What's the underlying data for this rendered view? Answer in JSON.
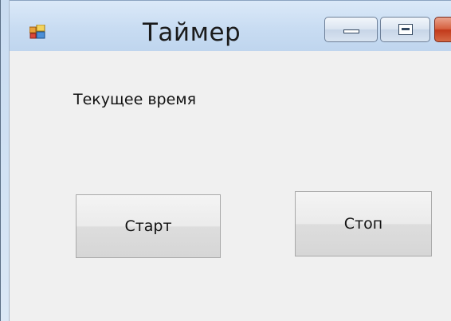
{
  "window": {
    "title": "Таймер",
    "app_icon": "windows-form-icon",
    "controls": {
      "minimize_icon": "minimize-icon",
      "maximize_icon": "maximize-icon",
      "close_icon": "close-icon"
    }
  },
  "form": {
    "current_time_label": "Текущее время",
    "start_button_label": "Старт",
    "stop_button_label": "Стоп"
  },
  "colors": {
    "client_background": "#f0f0f0",
    "titlebar": "#c8dcf2",
    "close_button": "#c2391a"
  }
}
